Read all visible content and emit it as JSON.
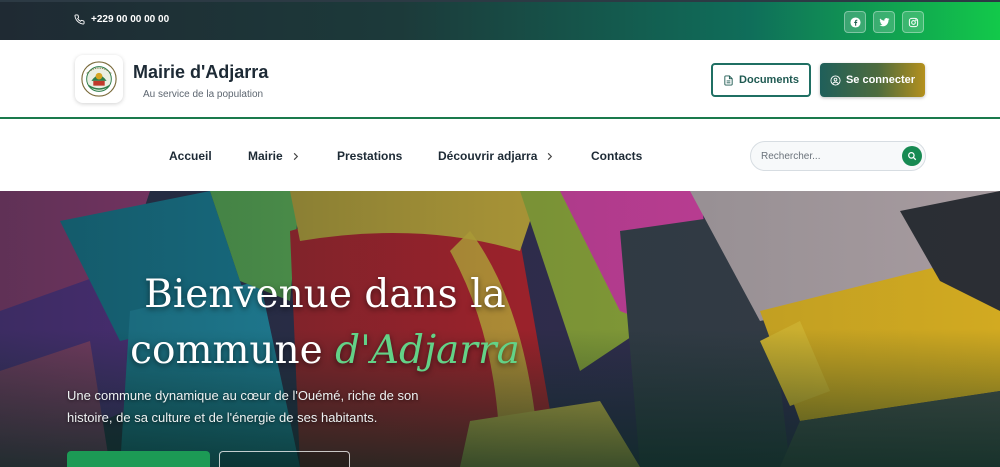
{
  "topbar": {
    "phone_icon": "phone-icon",
    "phone": "+229 00 00 00 00",
    "social": [
      {
        "name": "facebook",
        "icon": "facebook-icon"
      },
      {
        "name": "twitter",
        "icon": "twitter-icon"
      },
      {
        "name": "instagram",
        "icon": "instagram-icon"
      }
    ],
    "gradient": [
      "#1f2a33",
      "#0f6e5a",
      "#12c94a"
    ]
  },
  "header": {
    "logo_icon": "commune-seal-logo",
    "title": "Mairie d'Adjarra",
    "subtitle": "Au service de la population",
    "documents_label": "Documents",
    "documents_icon": "document-icon",
    "login_label": "Se connecter",
    "login_icon": "user-circle-icon",
    "accent": "#1a7a4c"
  },
  "nav": {
    "items": [
      {
        "label": "Accueil",
        "has_submenu": false
      },
      {
        "label": "Mairie",
        "has_submenu": true
      },
      {
        "label": "Prestations",
        "has_submenu": false
      },
      {
        "label": "Découvrir adjarra",
        "has_submenu": true
      },
      {
        "label": "Contacts",
        "has_submenu": false
      }
    ],
    "search_placeholder": "Rechercher...",
    "search_icon": "search-icon"
  },
  "hero": {
    "title_line1": "Bienvenue dans la",
    "title_line2_plain": "commune ",
    "title_line2_accent": "d'Adjarra",
    "description": "Une commune dynamique au cœur de l'Ouémé, riche de son histoire, de sa culture et de l'énergie de ses habitants.",
    "accent_color": "#63d287",
    "primary_button_color": "#1c9a55"
  }
}
